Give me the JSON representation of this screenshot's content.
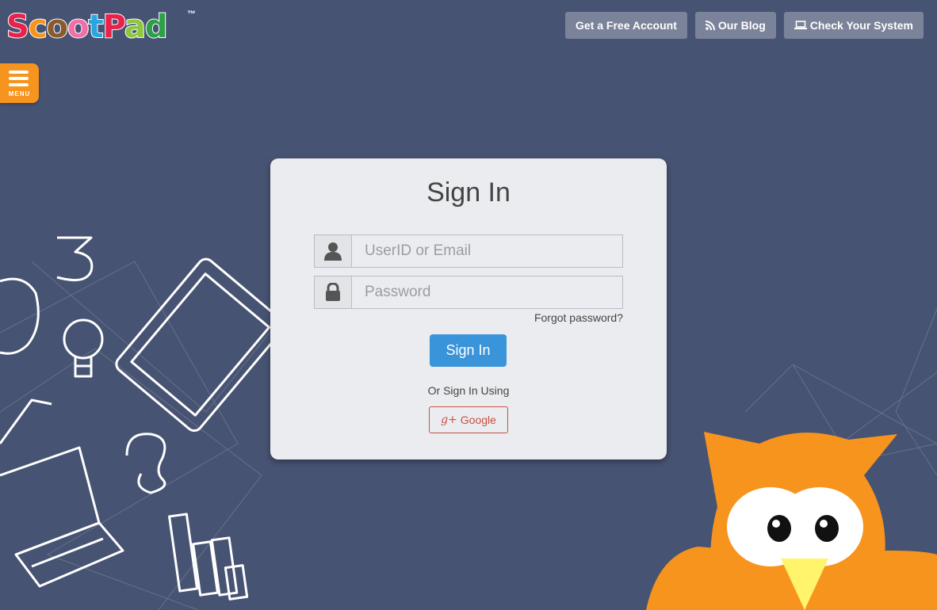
{
  "app": {
    "logo_text": [
      "S",
      "c",
      "o",
      "o",
      "t",
      "P",
      "a",
      "d"
    ],
    "logo_colors": [
      "#e8234b",
      "#f7941d",
      "#8b5a2b",
      "#f06fa8",
      "#29a5e0",
      "#e8234b",
      "#8dc63f",
      "#2e9e48"
    ],
    "trademark": "™"
  },
  "top_nav": {
    "free_account": "Get a Free Account",
    "blog": "Our Blog",
    "check_system": "Check Your System"
  },
  "menu": {
    "label": "MENU"
  },
  "signin_card": {
    "title": "Sign In",
    "userid_placeholder": "UserID or Email",
    "password_placeholder": "Password",
    "forgot": "Forgot password?",
    "submit": "Sign In",
    "or_text": "Or Sign In Using",
    "google": "Google",
    "google_icon": "g+"
  },
  "colors": {
    "background": "#475372",
    "accent_orange": "#f7941d",
    "primary_button": "#3a94d9",
    "google_red": "#c94f43"
  }
}
